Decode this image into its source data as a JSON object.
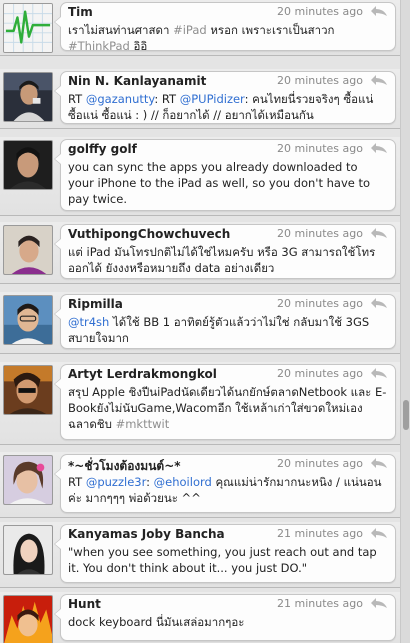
{
  "tweets": [
    {
      "author": "Tim",
      "time": "20 minutes ago",
      "avatar": "chart-icon",
      "segments": [
        {
          "t": "text",
          "v": "เราไม่สนท่านศาสดา "
        },
        {
          "t": "hashtag",
          "v": "#iPad"
        },
        {
          "t": "text",
          "v": " หรอก เพราะเราเป็นสาวก "
        },
        {
          "t": "hashtag",
          "v": "#ThinkPad"
        },
        {
          "t": "text",
          "v": " อิอิ"
        }
      ]
    },
    {
      "author": "Nin N. Kanlayanamit",
      "time": "20 minutes ago",
      "avatar": "person-photo",
      "segments": [
        {
          "t": "text",
          "v": "RT "
        },
        {
          "t": "mention",
          "v": "@gazanutty"
        },
        {
          "t": "text",
          "v": ": RT "
        },
        {
          "t": "mention",
          "v": "@PUPidizer"
        },
        {
          "t": "text",
          "v": ": คนไทยนี่รวยจริงๆ ซื้อแน่ ซื้อแน่ ซื้อแน่ : ) // ก็อยากได้ // อยากได้เหมือนกัน"
        }
      ]
    },
    {
      "author": "golffy golf",
      "time": "20 minutes ago",
      "avatar": "person-photo",
      "segments": [
        {
          "t": "text",
          "v": "you can sync the apps you already downloaded to your iPhone to the iPad as well, so you don't have to pay twice."
        }
      ]
    },
    {
      "author": "VuthipongChowchuvech",
      "time": "20 minutes ago",
      "avatar": "person-photo",
      "segments": [
        {
          "t": "text",
          "v": "แต่ iPad มันโทรปกติไม่ได้ใช่ไหมครับ หรือ 3G สามารถใช้โทรออกได้ ยังงงหรือหมายถึง data อย่างเดียว"
        }
      ]
    },
    {
      "author": "Ripmilla",
      "time": "20 minutes ago",
      "avatar": "person-photo",
      "segments": [
        {
          "t": "mention",
          "v": "@tr4sh"
        },
        {
          "t": "text",
          "v": " ได้ใช้ BB 1 อาทิตย์รู้ตัวแล้วว่าไม่ใช่ กลับมาใช้ 3GS สบายใจมาก"
        }
      ]
    },
    {
      "author": "Artyt Lerdrakmongkol",
      "time": "20 minutes ago",
      "avatar": "person-photo",
      "segments": [
        {
          "t": "text",
          "v": "สรุป Apple ชิงปีนiPadนัดเดียวได้นกยักษ์ตลาดNetbook และ E-Bookยังไม่นับGame,Wacomอีก ใช้เหล้าเก่าใส่ขวดใหม่เองฉลาดชิบ "
        },
        {
          "t": "hashtag",
          "v": "#mkttwit"
        }
      ]
    },
    {
      "author": "*~ชั่วโมงต้องมนต์~*",
      "time": "20 minutes ago",
      "avatar": "person-photo",
      "segments": [
        {
          "t": "text",
          "v": "RT "
        },
        {
          "t": "mention",
          "v": "@puzzle3r"
        },
        {
          "t": "text",
          "v": ": "
        },
        {
          "t": "mention",
          "v": "@ehoilord"
        },
        {
          "t": "text",
          "v": " คุณแม่น่ารักมากนะหนิง / แน่นอนค่ะ มากๆๆๆ พ่อด้วยนะ ^^"
        }
      ]
    },
    {
      "author": "Kanyamas Joby Bancha",
      "time": "21 minutes ago",
      "avatar": "person-photo",
      "segments": [
        {
          "t": "text",
          "v": "\"when you see something, you just reach out and tap it. You don't think about it... you just DO.\""
        }
      ]
    },
    {
      "author": "Hunt",
      "time": "21 minutes ago",
      "avatar": "person-photo",
      "segments": [
        {
          "t": "text",
          "v": "dock keyboard นี่มันเสล่อมากๆอะ"
        }
      ]
    }
  ],
  "colors": {
    "mention": "#2f6ed1",
    "hashtag": "#8e8e8e",
    "timestamp": "#8a8a8a",
    "author": "#222222"
  }
}
